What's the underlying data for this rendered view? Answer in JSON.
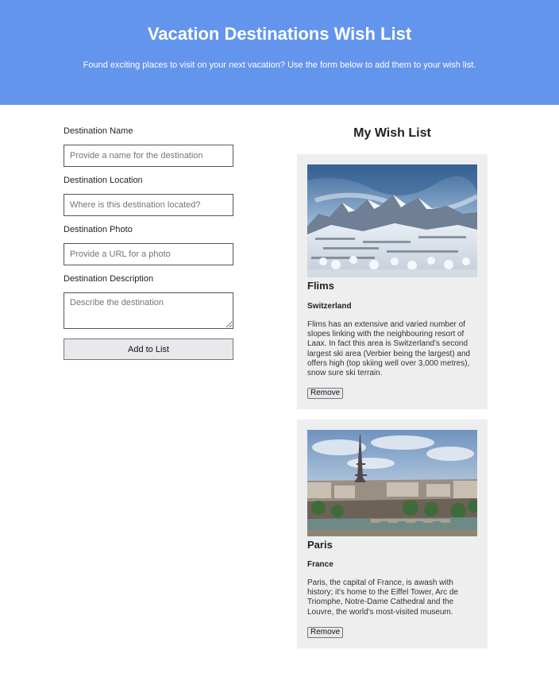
{
  "header": {
    "title": "Vacation Destinations Wish List",
    "subtitle": "Found exciting places to visit on your next vacation? Use the form below to add them to your wish list."
  },
  "form": {
    "name_label": "Destination Name",
    "name_placeholder": "Provide a name for the destination",
    "location_label": "Destination Location",
    "location_placeholder": "Where is this destination located?",
    "photo_label": "Destination Photo",
    "photo_placeholder": "Provide a URL for a photo",
    "description_label": "Destination Description",
    "description_placeholder": "Describe the destination",
    "submit_label": "Add to List"
  },
  "wishlist": {
    "title": "My Wish List",
    "cards": [
      {
        "name": "Flims",
        "location": "Switzerland",
        "description": "Flims has an extensive and varied number of slopes linking with the neighbouring resort of Laax. In fact this area is Switzerland's second largest ski area (Verbier being the largest) and offers high (top skiing well over 3,000 metres), snow sure ski terrain.",
        "remove_label": "Remove"
      },
      {
        "name": "Paris",
        "location": "France",
        "description": "Paris, the capital of France, is awash with history; it's home to the Eiffel Tower, Arc de Triomphe, Notre-Dame Cathedral and the Louvre, the world's most-visited museum.",
        "remove_label": "Remove"
      }
    ]
  },
  "colors": {
    "header_bg": "#6495ed",
    "card_bg": "#eeeeee"
  }
}
